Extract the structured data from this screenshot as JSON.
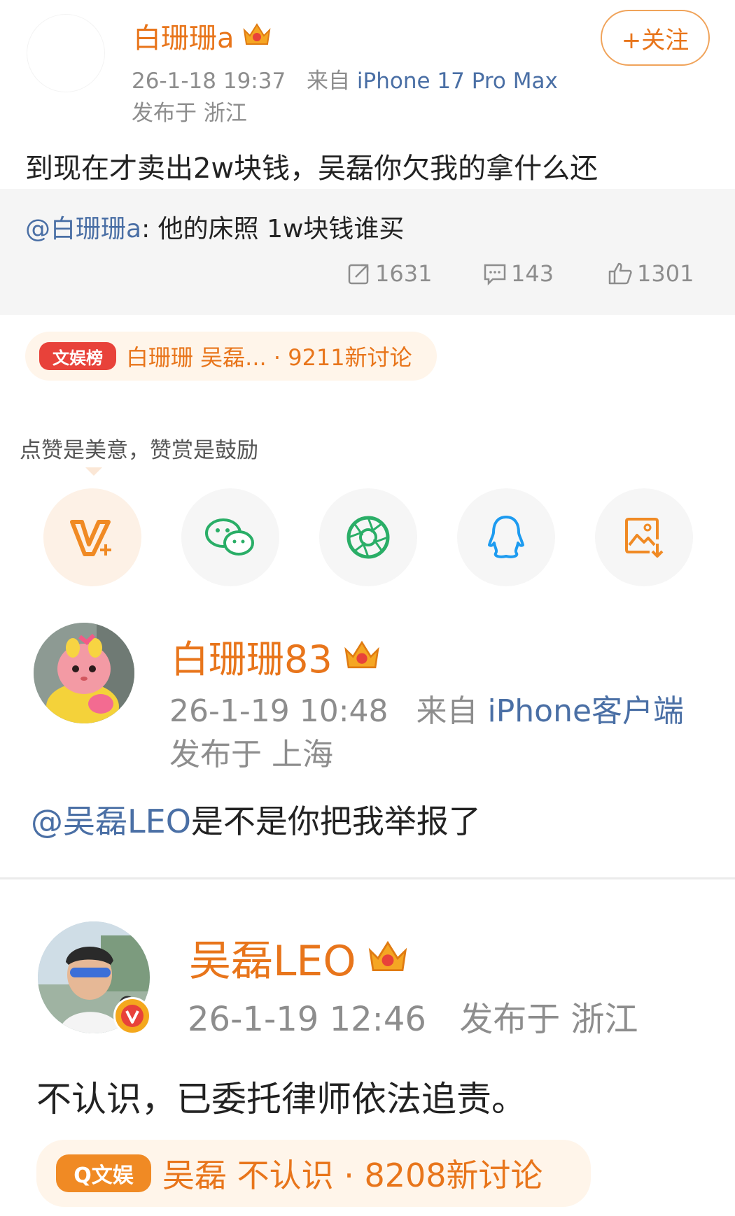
{
  "post": {
    "username": "白珊珊a",
    "time": "26-1-18 19:37",
    "from_label": "来自",
    "device": "iPhone 17 Pro Max",
    "location": "发布于 浙江",
    "follow_label": "+关注",
    "text": "到现在才卖出2w块钱，吴磊你欠我的拿什么还",
    "quoted_mention": "@白珊珊a",
    "quoted_text": ": 他的床照 1w块钱谁买",
    "reposts": "1631",
    "comments": "143",
    "likes": "1301"
  },
  "topic_pill": {
    "badge": "文娱榜",
    "text": "白珊珊 吴磊... · 9211新讨论"
  },
  "reward_hint": "点赞是美意，赞赏是鼓励",
  "share_icons": [
    "v-plus-icon",
    "wechat-icon",
    "moments-icon",
    "qq-icon",
    "save-image-icon"
  ],
  "post2": {
    "username": "白珊珊83",
    "time": "26-1-19 10:48",
    "from_label": "来自",
    "device": "iPhone客户端",
    "location": "发布于 上海",
    "mention": "@吴磊LEO",
    "text": "是不是你把我举报了"
  },
  "post3": {
    "username": "吴磊LEO",
    "time": "26-1-19 12:46",
    "location": "发布于 浙江",
    "text": "不认识，已委托律师依法追责。",
    "pill_badge": "Q文娱",
    "pill_text": "吴磊 不认识 · 8208新讨论"
  },
  "colors": {
    "orange": "#e8751b",
    "link_blue": "#4a6fa5",
    "meta_grey": "#8d8d8d"
  }
}
